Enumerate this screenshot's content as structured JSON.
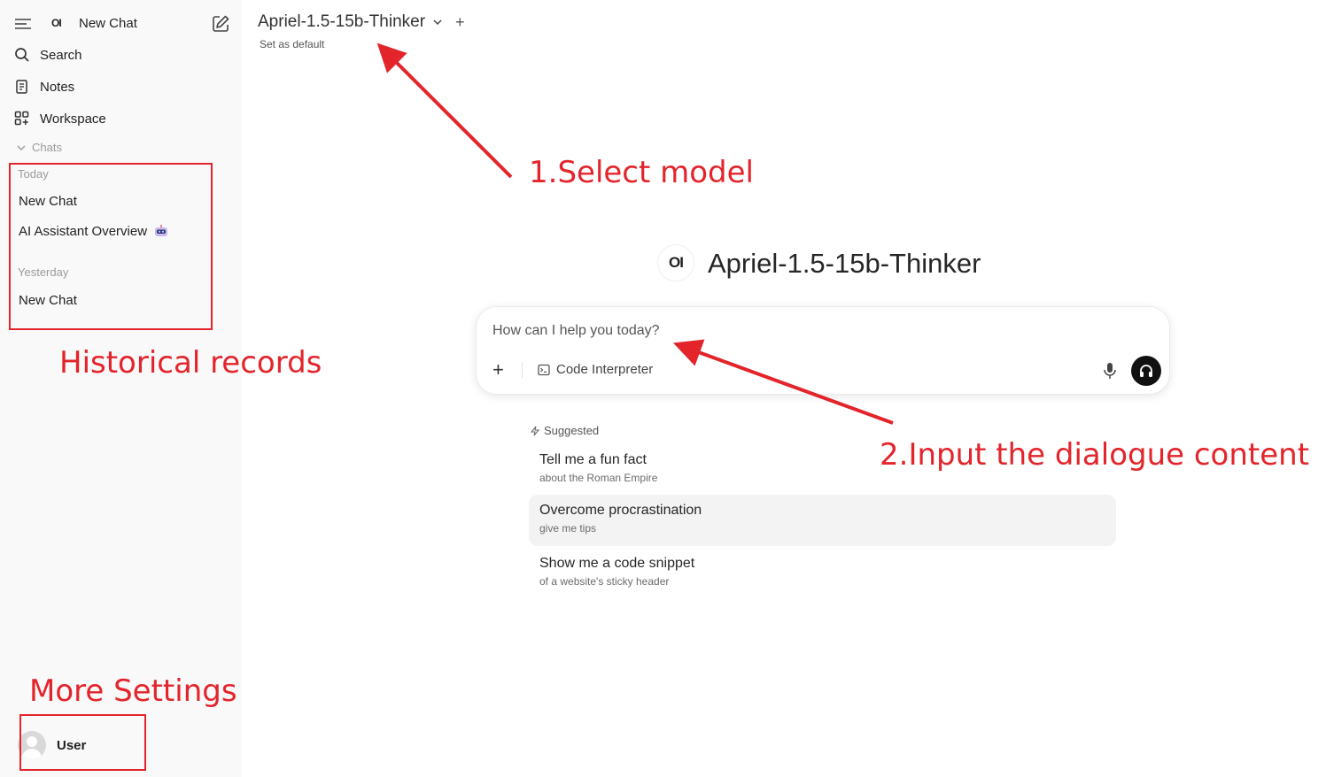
{
  "sidebar": {
    "logo": "OI",
    "title": "New Chat",
    "nav": [
      {
        "label": "Search"
      },
      {
        "label": "Notes"
      },
      {
        "label": "Workspace"
      }
    ],
    "chats_header": "Chats",
    "groups": [
      {
        "label": "Today",
        "items": [
          "New Chat",
          "AI Assistant Overview"
        ]
      },
      {
        "label": "Yesterday",
        "items": [
          "New Chat"
        ]
      }
    ],
    "user": {
      "name": "User"
    }
  },
  "header": {
    "model_name": "Apriel-1.5-15b-Thinker",
    "plus": "+",
    "set_default": "Set as default"
  },
  "main": {
    "logo": "OI",
    "title": "Apriel-1.5-15b-Thinker",
    "input": {
      "placeholder": "How can I help you today?",
      "plus": "+",
      "code_interpreter": "Code Interpreter"
    },
    "suggested_header": "Suggested",
    "suggestions": [
      {
        "title": "Tell me a fun fact",
        "subtitle": "about the Roman Empire"
      },
      {
        "title": "Overcome procrastination",
        "subtitle": "give me tips"
      },
      {
        "title": "Show me a code snippet",
        "subtitle": "of a website's sticky header"
      }
    ]
  },
  "annotations": {
    "select_model": "1.Select model",
    "historical_records": "Historical records",
    "input_dialogue": "2.Input the dialogue content",
    "more_settings": "More Settings",
    "color": "#e3242b"
  },
  "icons": [
    "menu-icon",
    "pencil-square-icon",
    "search-icon",
    "notes-icon",
    "workspace-grid-icon",
    "chevron-down-icon",
    "robot-emoji-icon",
    "user-avatar-icon",
    "terminal-icon",
    "microphone-icon",
    "headphones-icon",
    "bolt-icon"
  ]
}
